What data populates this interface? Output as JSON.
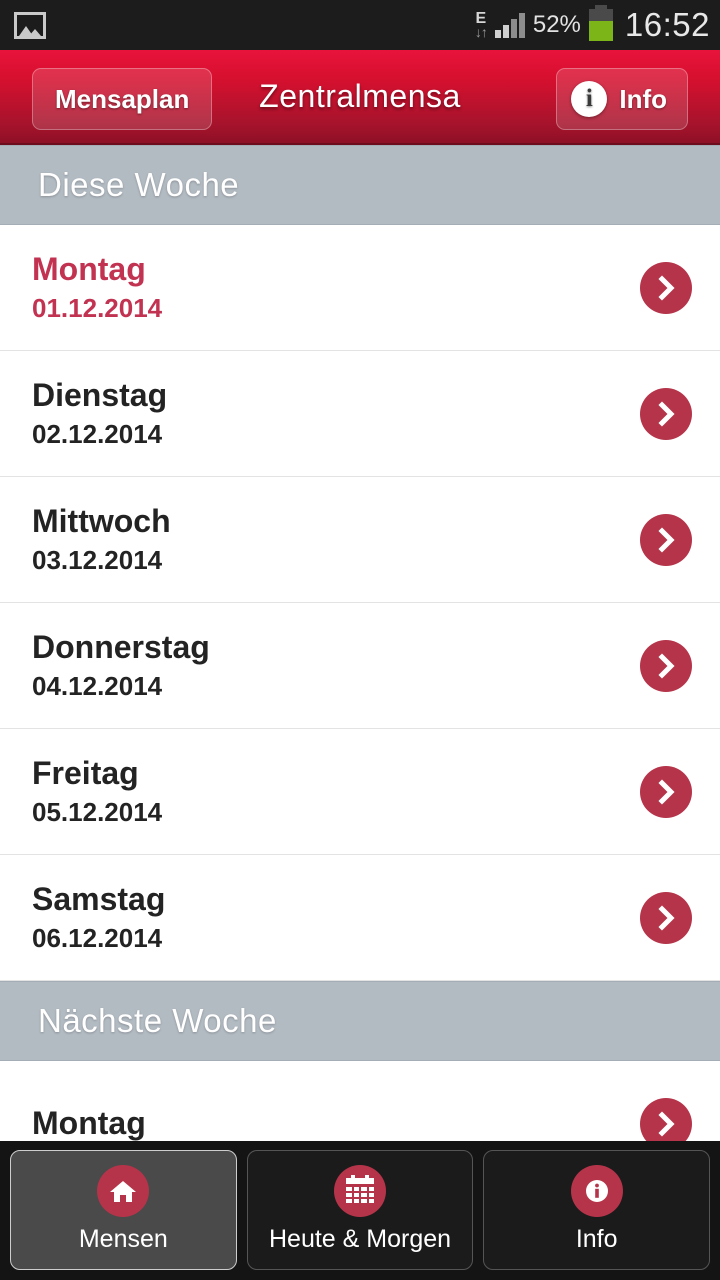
{
  "statusbar": {
    "notification_icon": "photo-icon",
    "network_type": "E",
    "network_arrows": "↓↑",
    "signal_icon": "signal-bars-icon",
    "battery_percent": "52%",
    "battery_icon": "battery-icon",
    "time": "16:52"
  },
  "header": {
    "back_label": "Mensaplan",
    "title": "Zentralmensa",
    "info_label": "Info",
    "info_icon": "info-icon",
    "accent_color": "#d7102f"
  },
  "sections": [
    {
      "title": "Diese Woche",
      "rows": [
        {
          "day": "Montag",
          "date": "01.12.2014",
          "today": true
        },
        {
          "day": "Dienstag",
          "date": "02.12.2014",
          "today": false
        },
        {
          "day": "Mittwoch",
          "date": "03.12.2014",
          "today": false
        },
        {
          "day": "Donnerstag",
          "date": "04.12.2014",
          "today": false
        },
        {
          "day": "Freitag",
          "date": "05.12.2014",
          "today": false
        },
        {
          "day": "Samstag",
          "date": "06.12.2014",
          "today": false
        }
      ]
    },
    {
      "title": "Nächste Woche",
      "rows": [
        {
          "day": "Montag",
          "date": "",
          "today": false
        }
      ]
    }
  ],
  "tabbar": {
    "tabs": [
      {
        "label": "Mensen",
        "icon": "home-icon",
        "active": true
      },
      {
        "label": "Heute & Morgen",
        "icon": "calendar-icon",
        "active": false
      },
      {
        "label": "Info",
        "icon": "info-icon",
        "active": false
      }
    ]
  },
  "colors": {
    "accent_red": "#b5344a",
    "header_red": "#d7102f",
    "section_gray": "#b2bac2",
    "today_text": "#c23352",
    "row_text": "#232323"
  }
}
